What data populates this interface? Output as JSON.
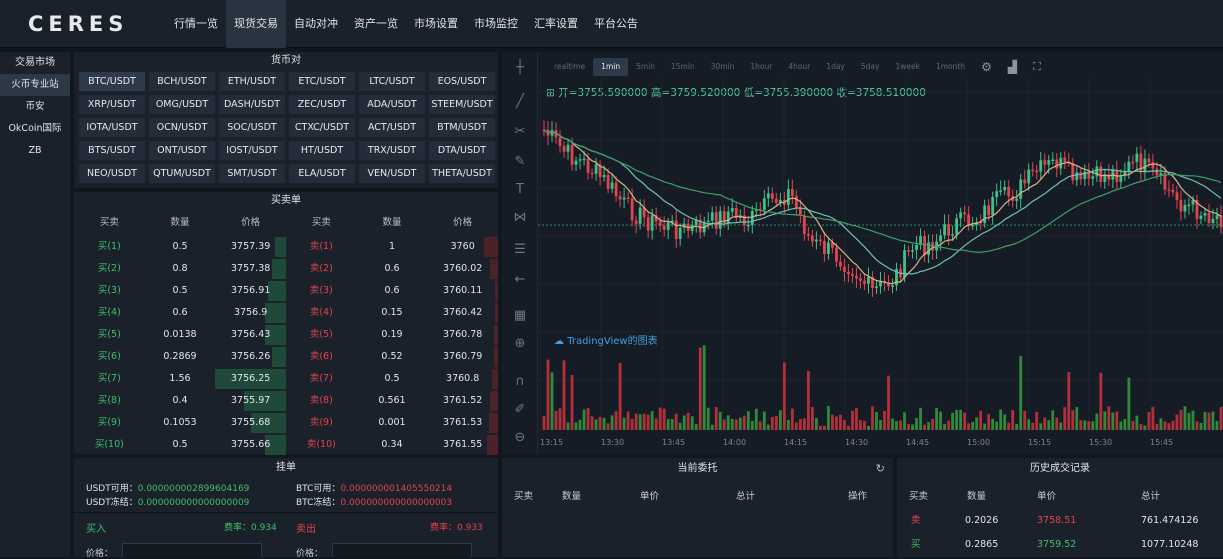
{
  "brand": "CERES",
  "nav": [
    "行情一览",
    "现货交易",
    "自动对冲",
    "资产一览",
    "市场设置",
    "市场监控",
    "汇率设置",
    "平台公告"
  ],
  "nav_active": "现货交易",
  "sidebar": {
    "title": "交易市场",
    "items": [
      "火币专业站",
      "币安",
      "OkCoin国际",
      "ZB"
    ],
    "active": "火币专业站"
  },
  "pairs": {
    "title": "货币对",
    "selected": "BTC/USDT",
    "items": [
      "BTC/USDT",
      "BCH/USDT",
      "ETH/USDT",
      "ETC/USDT",
      "LTC/USDT",
      "EOS/USDT",
      "XRP/USDT",
      "OMG/USDT",
      "DASH/USDT",
      "ZEC/USDT",
      "ADA/USDT",
      "STEEM/USDT",
      "IOTA/USDT",
      "OCN/USDT",
      "SOC/USDT",
      "CTXC/USDT",
      "ACT/USDT",
      "BTM/USDT",
      "BTS/USDT",
      "ONT/USDT",
      "IOST/USDT",
      "HT/USDT",
      "TRX/USDT",
      "DTA/USDT",
      "NEO/USDT",
      "QTUM/USDT",
      "SMT/USDT",
      "ELA/USDT",
      "VEN/USDT",
      "THETA/USDT"
    ]
  },
  "orderbook": {
    "title": "买卖单",
    "headers": [
      "买卖",
      "数量",
      "价格",
      "买卖",
      "数量",
      "价格"
    ],
    "rows": [
      {
        "bid": "买(1)",
        "bid_qty": "0.5",
        "bid_price": "3757.39",
        "ask": "卖(1)",
        "ask_qty": "1",
        "ask_price": "3760",
        "bid_depth": 0.15,
        "ask_depth": 0.2
      },
      {
        "bid": "买(2)",
        "bid_qty": "0.8",
        "bid_price": "3757.38",
        "ask": "卖(2)",
        "ask_qty": "0.6",
        "ask_price": "3760.02",
        "bid_depth": 0.2,
        "ask_depth": 0.12
      },
      {
        "bid": "买(3)",
        "bid_qty": "0.5",
        "bid_price": "3756.91",
        "ask": "卖(3)",
        "ask_qty": "0.6",
        "ask_price": "3760.11",
        "bid_depth": 0.25,
        "ask_depth": 0.04
      },
      {
        "bid": "买(4)",
        "bid_qty": "0.6",
        "bid_price": "3756.9",
        "ask": "卖(4)",
        "ask_qty": "0.15",
        "ask_price": "3760.42",
        "bid_depth": 0.3,
        "ask_depth": 0.04
      },
      {
        "bid": "买(5)",
        "bid_qty": "0.0138",
        "bid_price": "3756.43",
        "ask": "卖(5)",
        "ask_qty": "0.19",
        "ask_price": "3760.78",
        "bid_depth": 0.3,
        "ask_depth": 0.05
      },
      {
        "bid": "买(6)",
        "bid_qty": "0.2869",
        "bid_price": "3756.26",
        "ask": "卖(6)",
        "ask_qty": "0.52",
        "ask_price": "3760.79",
        "bid_depth": 0.2,
        "ask_depth": 0.06
      },
      {
        "bid": "买(7)",
        "bid_qty": "1.56",
        "bid_price": "3756.25",
        "ask": "卖(7)",
        "ask_qty": "0.5",
        "ask_price": "3760.8",
        "bid_depth": 1.0,
        "ask_depth": 0.08
      },
      {
        "bid": "买(8)",
        "bid_qty": "0.4",
        "bid_price": "3755.97",
        "ask": "卖(8)",
        "ask_qty": "0.561",
        "ask_price": "3761.52",
        "bid_depth": 0.6,
        "ask_depth": 0.12
      },
      {
        "bid": "买(9)",
        "bid_qty": "0.1053",
        "bid_price": "3755.68",
        "ask": "卖(9)",
        "ask_qty": "0.001",
        "ask_price": "3761.53",
        "bid_depth": 0.5,
        "ask_depth": 0.13
      },
      {
        "bid": "买(10)",
        "bid_qty": "0.5",
        "bid_price": "3755.66",
        "ask": "卖(10)",
        "ask_qty": "0.34",
        "ask_price": "3761.55",
        "bid_depth": 0.3,
        "ask_depth": 0.15
      }
    ]
  },
  "chart": {
    "intervals": [
      "realtime",
      "1min",
      "5min",
      "15min",
      "30min",
      "1hour",
      "4hour",
      "1day",
      "5day",
      "1week",
      "1month"
    ],
    "selected_interval": "1min",
    "ohlc": "开=3755.590000 高=3759.520000 低=3755.390000 收=3758.510000",
    "watermark": "TradingView的图表",
    "xticks": [
      "13:15",
      "13:30",
      "13:45",
      "14:00",
      "14:15",
      "14:30",
      "14:45",
      "15:00",
      "15:15",
      "15:30",
      "15:45"
    ]
  },
  "orders_panel": {
    "title": "挂单",
    "usdt_avail_label": "USDT可用：",
    "usdt_avail": "0.000000002899604169",
    "usdt_frozen_label": "USDT冻结：",
    "usdt_frozen": "0.000000000000000009",
    "btc_avail_label": "BTC可用：",
    "btc_avail": "0.000000001405550214",
    "btc_frozen_label": "BTC冻结：",
    "btc_frozen": "0.000000000000000003",
    "buy_label": "买入",
    "buy_fee": "费率：0.934",
    "sell_label": "卖出",
    "sell_fee": "费率：0.933",
    "price_label": "价格："
  },
  "current_orders": {
    "title": "当前委托",
    "headers": [
      "买卖",
      "数量",
      "单价",
      "总计",
      "操作"
    ]
  },
  "history": {
    "title": "历史成交记录",
    "headers": [
      "买卖",
      "数量",
      "单价",
      "总计"
    ],
    "rows": [
      {
        "side": "卖",
        "qty": "0.2026",
        "price": "3758.51",
        "total": "761.474126"
      },
      {
        "side": "买",
        "qty": "0.2865",
        "price": "3759.52",
        "total": "1077.10248"
      }
    ]
  },
  "colors": {
    "buy": "#3fbf6b",
    "sell": "#e2444e",
    "accent": "#3f9fe0"
  }
}
